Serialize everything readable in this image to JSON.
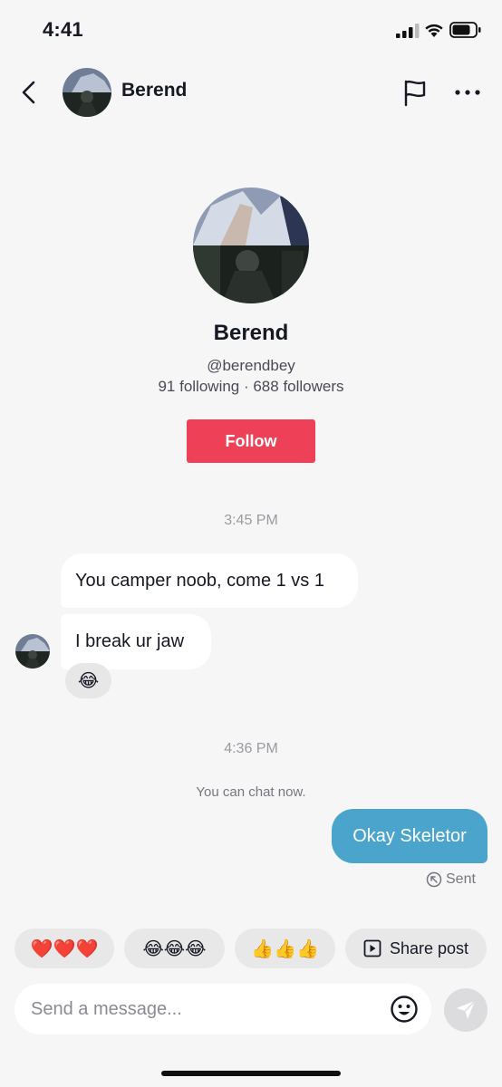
{
  "status_bar": {
    "time": "4:41"
  },
  "header": {
    "name": "Berend"
  },
  "profile": {
    "name": "Berend",
    "handle": "@berendbey",
    "stats": "91 following · 688 followers",
    "follow_label": "Follow"
  },
  "conversation": {
    "timestamp_1": "3:45 PM",
    "incoming": [
      {
        "text": "You camper noob, come 1 vs 1"
      },
      {
        "text": "I break ur jaw"
      }
    ],
    "reaction": "😂",
    "timestamp_2": "4:36 PM",
    "system_note": "You can chat now.",
    "outgoing": {
      "text": "Okay Skeletor",
      "status": "Sent"
    }
  },
  "quick_replies": [
    {
      "label": "❤️❤️❤️"
    },
    {
      "label": "😂😂😂"
    },
    {
      "label": "👍👍👍"
    },
    {
      "label": "Share post",
      "icon": "play-square-icon"
    }
  ],
  "composer": {
    "placeholder": "Send a message..."
  },
  "colors": {
    "follow": "#ee4158",
    "outgoing_bubble": "#4aa4cb",
    "background": "#f6f6f6"
  }
}
